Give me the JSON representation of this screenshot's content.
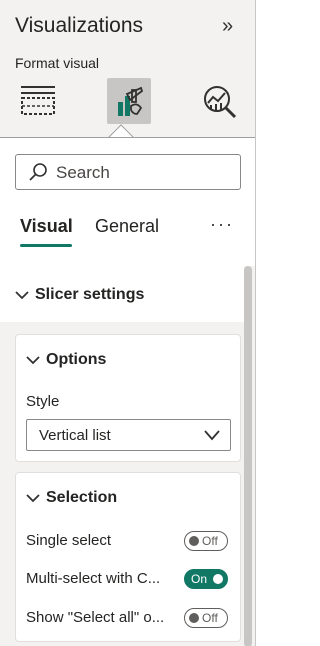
{
  "pane": {
    "title": "Visualizations",
    "collapse_glyph": "»",
    "subtitle": "Format visual"
  },
  "icons": {
    "build": "build-visual-icon",
    "format": "format-visual-icon",
    "analytics": "analytics-icon"
  },
  "search": {
    "placeholder": "Search"
  },
  "tabs": [
    {
      "label": "Visual",
      "active": true
    },
    {
      "label": "General",
      "active": false
    }
  ],
  "more_label": "···",
  "slicer_settings": {
    "label": "Slicer settings"
  },
  "options": {
    "title": "Options",
    "style_label": "Style",
    "style_value": "Vertical list"
  },
  "selection": {
    "title": "Selection",
    "rows": [
      {
        "label": "Single select",
        "toggle": "Off"
      },
      {
        "label": "Multi-select with C...",
        "toggle": "On"
      },
      {
        "label": "Show \"Select all\" o...",
        "toggle": "Off"
      }
    ]
  },
  "colors": {
    "accent": "#117865"
  }
}
